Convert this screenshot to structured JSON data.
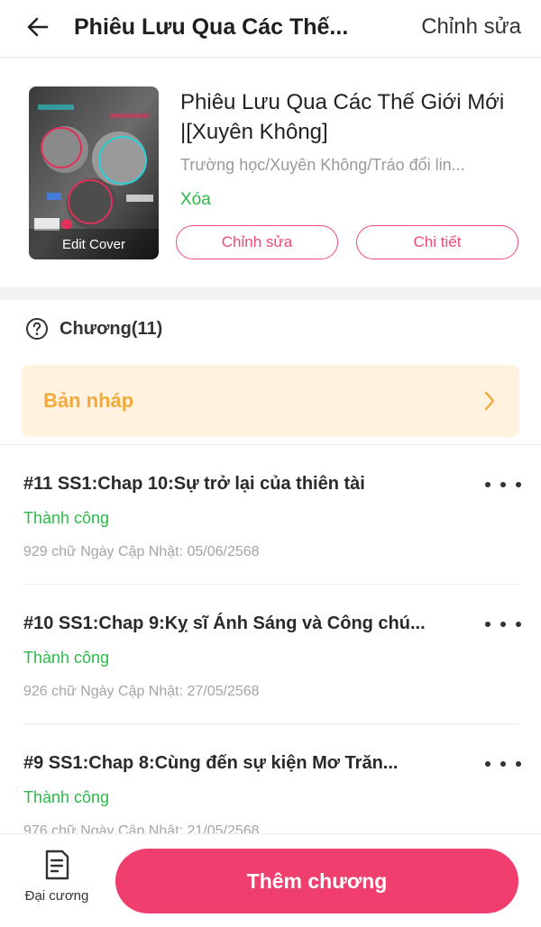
{
  "header": {
    "title": "Phiêu Lưu Qua Các Thế...",
    "edit_label": "Chỉnh sửa"
  },
  "story": {
    "title": "Phiêu Lưu Qua Các Thế Giới Mới |[Xuyên Không]",
    "genres": "Trường học/Xuyên Không/Tráo đổi lin...",
    "delete_label": "Xóa",
    "cover_label": "Edit Cover",
    "edit_button": "Chỉnh sửa",
    "detail_button": "Chi tiết"
  },
  "chapters": {
    "heading": "Chương(11)",
    "draft_label": "Bản nháp",
    "items": [
      {
        "title": "#11 SS1:Chap 10:Sự trở lại của thiên tài",
        "status": "Thành công",
        "meta": "929 chữ Ngày Cập Nhật: 05/06/2568"
      },
      {
        "title": "#10 SS1:Chap 9:Kỵ sĩ Ánh Sáng và Công chú...",
        "status": "Thành công",
        "meta": "926 chữ Ngày Cập Nhật: 27/05/2568"
      },
      {
        "title": "#9 SS1:Chap 8:Cùng đến sự kiện Mơ Trăn...",
        "status": "Thành công",
        "meta": "976 chữ Ngày Cập Nhật: 21/05/2568"
      }
    ]
  },
  "bottom": {
    "outline_label": "Đại cương",
    "add_chapter_label": "Thêm chương"
  },
  "icons": {
    "back": "arrow-left-icon",
    "help": "question-circle-icon",
    "chevron": "chevron-right-icon",
    "more": "more-dots-icon",
    "outline": "document-icon"
  },
  "colors": {
    "accent": "#f03f6e",
    "success": "#2db84a",
    "draft_bg": "#fff3e0",
    "draft_text": "#f3a93b"
  }
}
